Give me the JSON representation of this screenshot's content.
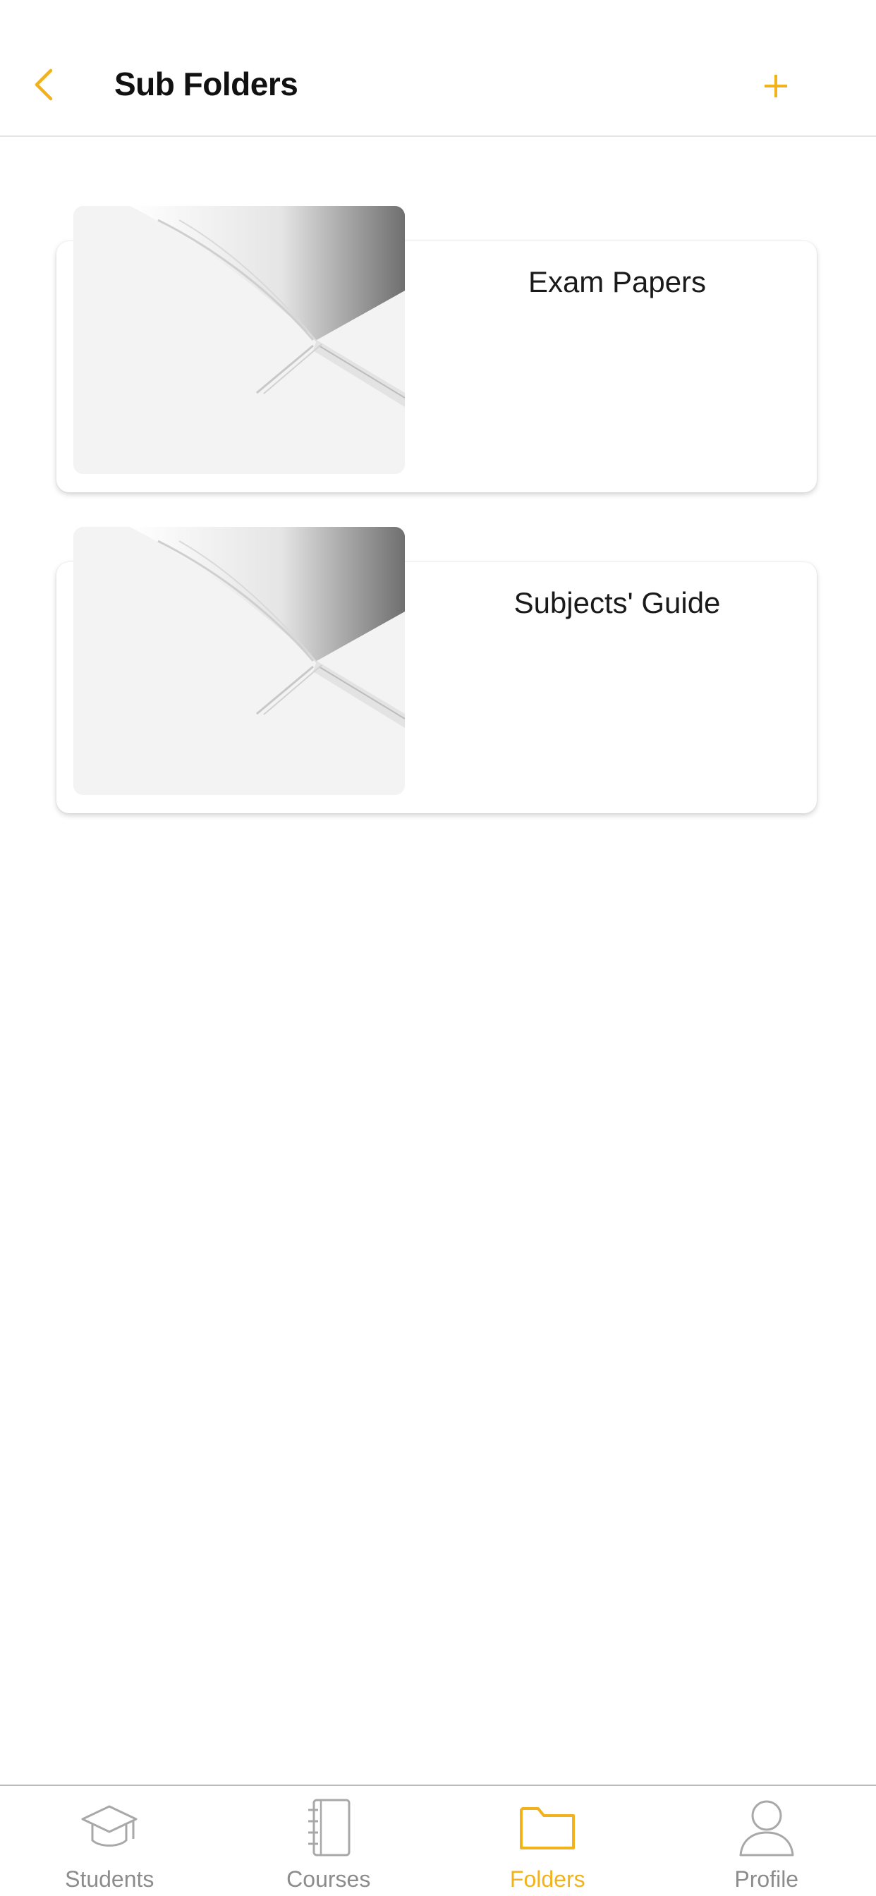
{
  "header": {
    "title": "Sub Folders",
    "back_icon": "chevron-left-icon",
    "add_icon": "plus-icon"
  },
  "folders": [
    {
      "label": "Exam Papers",
      "thumbnail": "open-book-image"
    },
    {
      "label": "Subjects' Guide",
      "thumbnail": "open-book-image"
    }
  ],
  "bottom_nav": {
    "items": [
      {
        "label": "Students",
        "icon": "graduation-cap-icon",
        "active": false
      },
      {
        "label": "Courses",
        "icon": "notebook-icon",
        "active": false
      },
      {
        "label": "Folders",
        "icon": "folder-icon",
        "active": true
      },
      {
        "label": "Profile",
        "icon": "user-icon",
        "active": false
      }
    ]
  },
  "colors": {
    "accent": "#f2b21b",
    "inactive": "#8c8c8c",
    "title_text": "#111111"
  }
}
